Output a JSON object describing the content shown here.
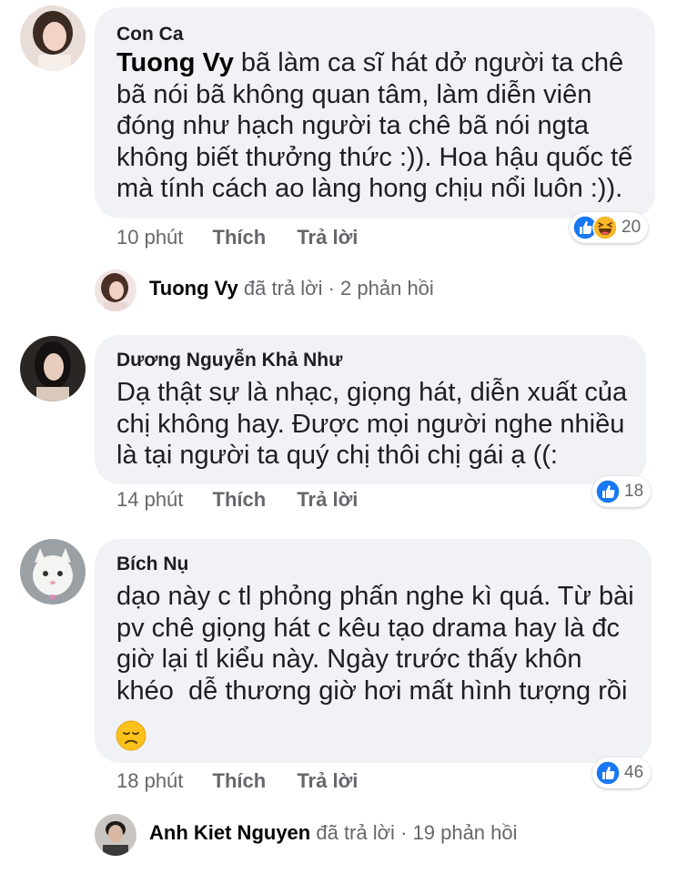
{
  "comments": [
    {
      "author": "Con Ca",
      "mention": "Tuong Vy",
      "lines": [
        " bã làm ca sĩ hát dở người ta chê",
        "bã nói bã không quan tâm, làm diễn viên",
        "đóng như hạch người ta chê bã nói ngta",
        "không biết thưởng thức :)). Hoa hậu quốc tế",
        "mà tính cách ao làng hong chịu nổi luôn :))."
      ],
      "time": "10 phút",
      "like": "Thích",
      "reply": "Trả lời",
      "reaction_icons": [
        "like-icon",
        "haha-icon"
      ],
      "reaction_count": "20",
      "reply_summary": {
        "name": "Tuong Vy",
        "action": "đã trả lời",
        "sep": "·",
        "count": "2 phản hồi"
      }
    },
    {
      "author": "Dương Nguyễn Khả Như",
      "lines": [
        "Dạ thật sự là nhạc, giọng hát, diễn xuất của",
        "chị không hay. Được mọi người nghe nhiều",
        "là tại người ta quý chị thôi chị gái ạ ((:"
      ],
      "time": "14 phút",
      "like": "Thích",
      "reply": "Trả lời",
      "reaction_icons": [
        "like-icon"
      ],
      "reaction_count": "18"
    },
    {
      "author": "Bích Nụ",
      "lines": [
        "dạo này c tl phỏng phấn nghe kì quá. Từ bài",
        "pv chê giọng hát c kêu tạo drama hay là đc",
        "giờ lại tl kiểu này. Ngày trước thấy khôn",
        "khéo  dễ thương giờ hơi mất hình tượng rồi"
      ],
      "emoji": "disappointed-face-icon",
      "time": "18 phút",
      "like": "Thích",
      "reply": "Trả lời",
      "reaction_icons": [
        "like-icon"
      ],
      "reaction_count": "46",
      "reply_summary": {
        "name": "Anh Kiet Nguyen",
        "action": "đã trả lời",
        "sep": "·",
        "count": "19 phản hồi"
      }
    }
  ],
  "colors": {
    "bubble": "#f0f2f5",
    "meta": "#65676b",
    "like_blue": "#1877f2",
    "haha_yellow": "#f7b928"
  }
}
